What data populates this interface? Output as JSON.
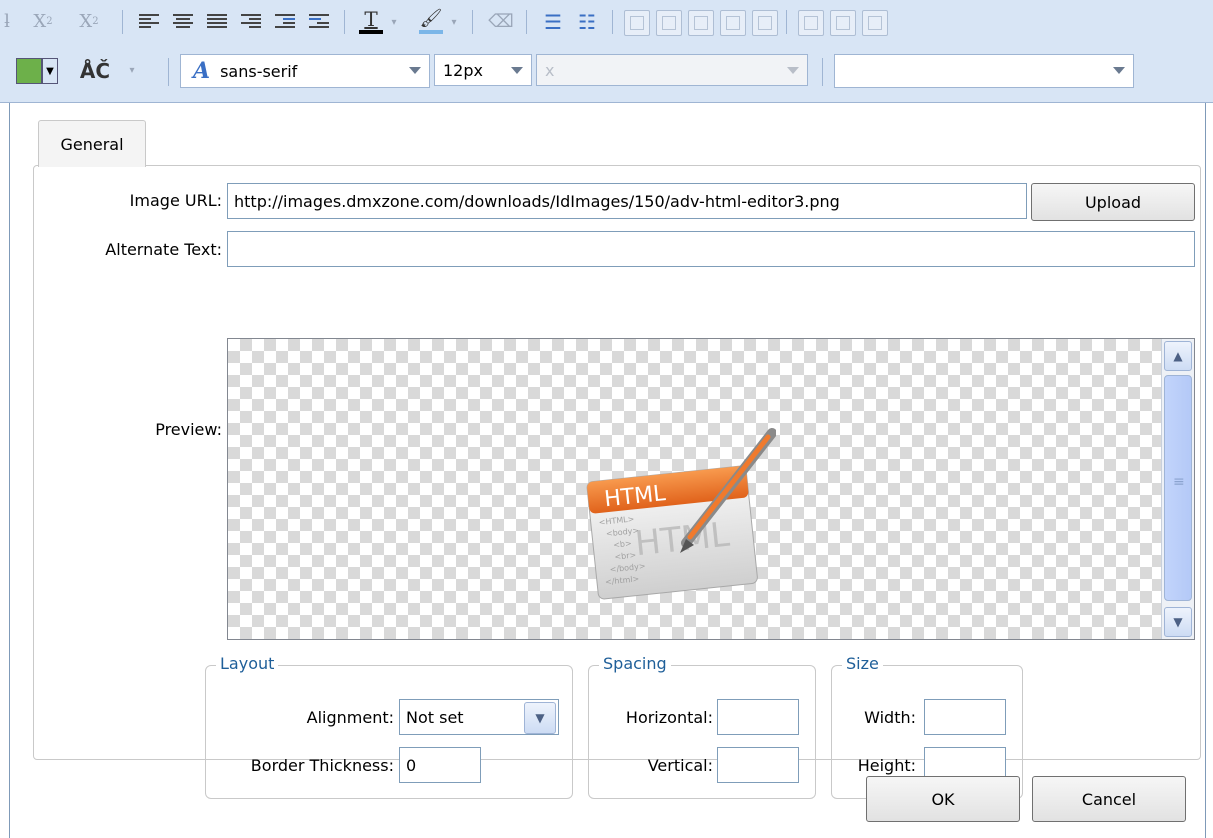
{
  "toolbar": {
    "font_family": "sans-serif",
    "font_size": "12px",
    "disabled_combo_value": "x",
    "style_combo_value": "",
    "spell_label": "ÅČ",
    "subscript_label": "X",
    "subscript_sub": "2",
    "superscript_label": "X",
    "superscript_sup": "2",
    "text_color_label": "T"
  },
  "dialog": {
    "tabs": [
      {
        "label": "General"
      }
    ],
    "image_url_label": "Image URL:",
    "image_url_value": "http://images.dmxzone.com/downloads/IdImages/150/adv-html-editor3.png",
    "upload_label": "Upload",
    "alt_text_label": "Alternate Text:",
    "alt_text_value": "",
    "preview_label": "Preview:",
    "preview_image_text": "HTML",
    "preview_watermark": "HTML",
    "preview_code_lines": [
      "<HTML>",
      "<body>",
      "<b>",
      "<br>",
      "</body>",
      "</html>"
    ],
    "layout": {
      "legend": "Layout",
      "alignment_label": "Alignment:",
      "alignment_value": "Not set",
      "border_label": "Border Thickness:",
      "border_value": "0"
    },
    "spacing": {
      "legend": "Spacing",
      "horizontal_label": "Horizontal:",
      "horizontal_value": "",
      "vertical_label": "Vertical:",
      "vertical_value": ""
    },
    "size": {
      "legend": "Size",
      "width_label": "Width:",
      "width_value": "",
      "height_label": "Height:",
      "height_value": ""
    },
    "ok_label": "OK",
    "cancel_label": "Cancel"
  },
  "colors": {
    "toolbar_bg": "#d8e5f5",
    "legend_text": "#1f5f99",
    "logo_orange": "#f07a2d"
  }
}
